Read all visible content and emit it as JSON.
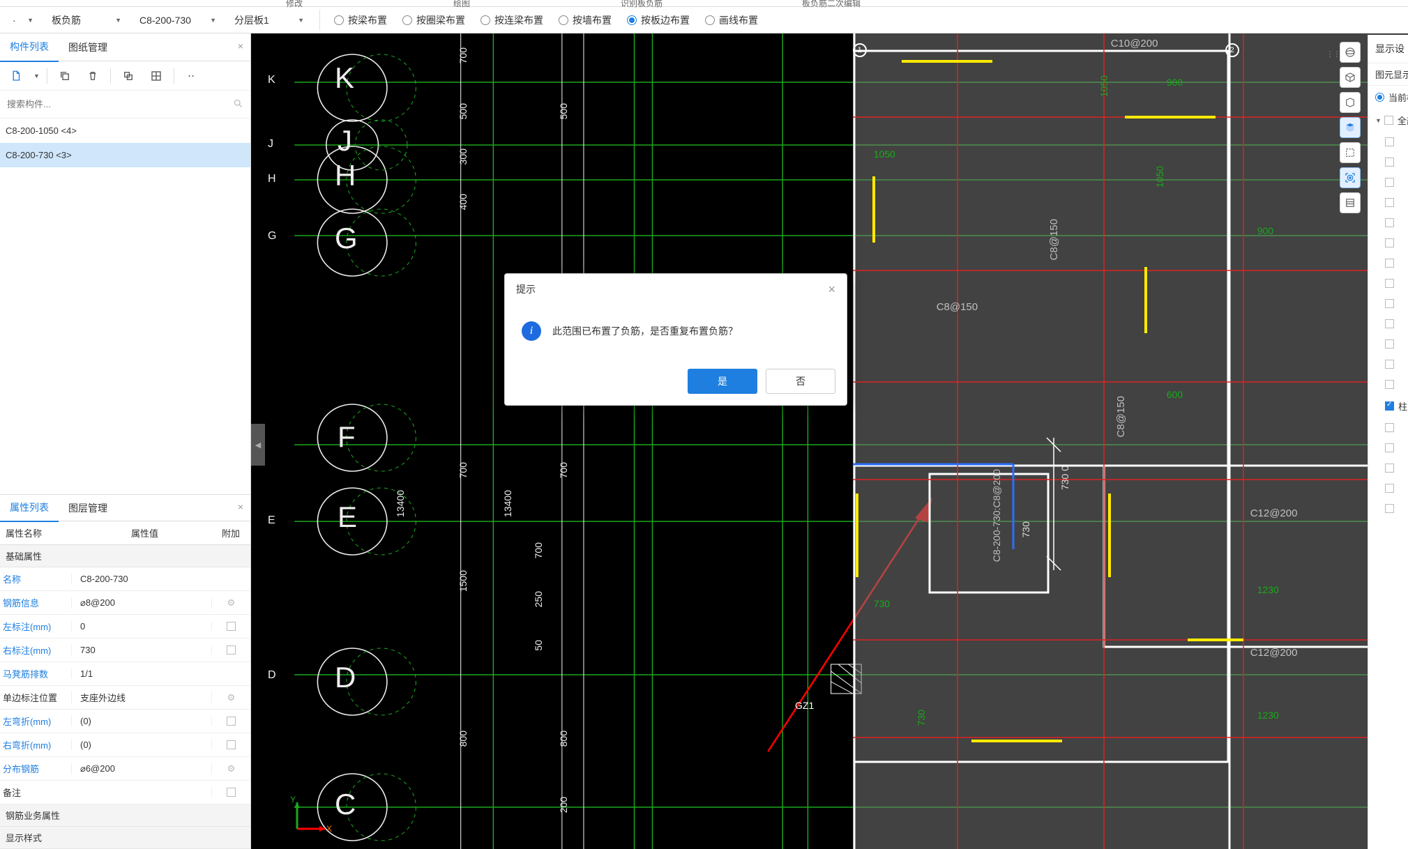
{
  "top_hints": {
    "h1": "",
    "h2": "",
    "h3": "修改",
    "h4": "绘图",
    "h5": "识别板负筋",
    "h6": "板负筋二次编辑"
  },
  "dropdowns": {
    "d1": "·",
    "d2": "板负筋",
    "d3": "C8-200-730",
    "d4": "分层板1"
  },
  "radio": {
    "r1": "按梁布置",
    "r2": "按圈梁布置",
    "r3": "按连梁布置",
    "r4": "按墙布置",
    "r5": "按板边布置",
    "r6": "画线布置"
  },
  "left_tabs": {
    "t1": "构件列表",
    "t2": "图纸管理"
  },
  "search": {
    "placeholder": "搜索构件..."
  },
  "components": {
    "c1": "C8-200-1050  <4>",
    "c2": "C8-200-730  <3>"
  },
  "prop_tabs": {
    "p1": "属性列表",
    "p2": "图层管理"
  },
  "prop_cols": {
    "c1": "属性名称",
    "c2": "属性值",
    "c3": "附加"
  },
  "prop_group": "基础属性",
  "props": [
    {
      "name": "名称",
      "value": "C8-200-730",
      "extra": ""
    },
    {
      "name": "钢筋信息",
      "value": "⌀8@200",
      "extra": "gear"
    },
    {
      "name": "左标注(mm)",
      "value": "0",
      "extra": "sq"
    },
    {
      "name": "右标注(mm)",
      "value": "730",
      "extra": "sq"
    },
    {
      "name": "马凳筋排数",
      "value": "1/1",
      "extra": ""
    },
    {
      "name": "单边标注位置",
      "value": "支座外边线",
      "extra": "gear"
    },
    {
      "name": "左弯折(mm)",
      "value": "(0)",
      "extra": "sq"
    },
    {
      "name": "右弯折(mm)",
      "value": "(0)",
      "extra": "sq"
    },
    {
      "name": "分布钢筋",
      "value": "⌀6@200",
      "extra": "gear"
    },
    {
      "name": "备注",
      "value": "",
      "extra": "sq"
    }
  ],
  "prop_biz": "钢筋业务属性",
  "prop_disp": "显示样式",
  "modal": {
    "title": "提示",
    "msg": "此范围已布置了负筋，是否重复布置负筋？",
    "yes": "是",
    "no": "否"
  },
  "disp": {
    "title": "显示设",
    "sub": "图元显示",
    "current": "当前楼层",
    "all": "全部",
    "checked_row": "柱"
  },
  "canvas": {
    "grid_letters": [
      "K",
      "J",
      "H",
      "G",
      "F",
      "E",
      "D",
      "C"
    ],
    "grid_nums": [
      "1",
      "2"
    ],
    "left_dims_v": [
      "700",
      "500",
      "300",
      "400",
      "1500",
      "700",
      "800"
    ],
    "right_dims_v": [
      "500",
      "700",
      "700",
      "250",
      "50",
      "800",
      "200"
    ],
    "big_v": [
      "13400",
      "13400"
    ],
    "gz": "GZ1",
    "plan": {
      "top_label": "C10@200",
      "dims_green": [
        "1050",
        "900",
        "1050",
        "600",
        "900",
        "1050",
        "1230",
        "1230",
        "730",
        "730"
      ],
      "c8_1": "C8@150",
      "c8_2": "C8@150",
      "c8_3": "C8@150",
      "c12_1": "C12@200",
      "c12_2": "C12@200",
      "sel": "C8-200-730:C8@200",
      "sel_l": "730",
      "sel_r": "730 0"
    }
  }
}
